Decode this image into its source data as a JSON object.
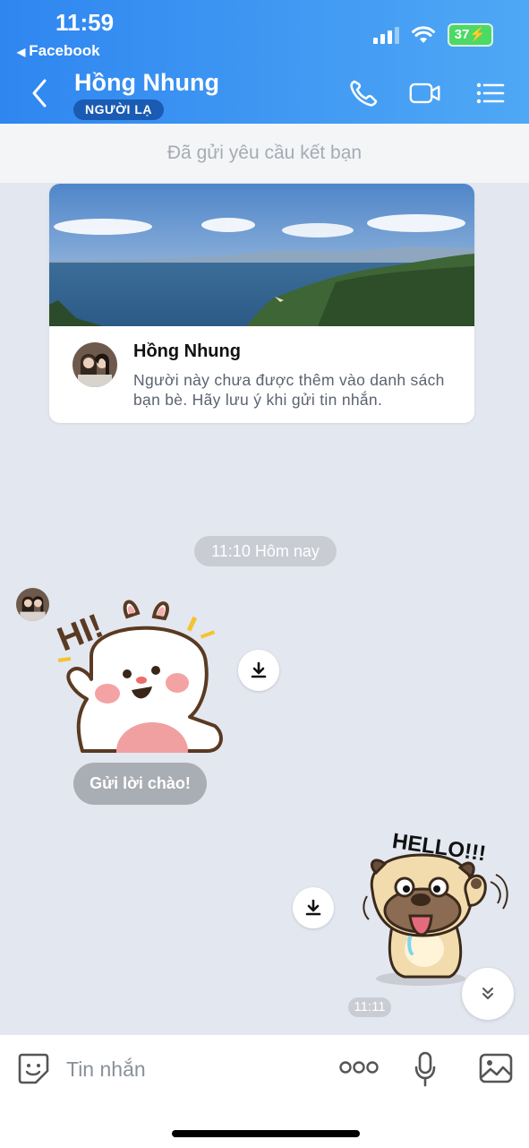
{
  "status_bar": {
    "time": "11:59",
    "back_app": "Facebook",
    "battery": "37"
  },
  "header": {
    "contact_name": "Hồng Nhung",
    "badge": "NGƯỜI LẠ"
  },
  "friend_request_bar": "Đã gửi yêu cầu kết bạn",
  "profile_card": {
    "name": "Hồng Nhung",
    "note": "Người này chưa được thêm vào danh sách bạn bè. Hãy lưu ý khi gửi tin nhắn."
  },
  "chat": {
    "time_separator": "11:10 Hôm nay",
    "bunny_sticker_text": "HI!",
    "greeting_button": "Gửi lời chào!",
    "pug_sticker_text": "HELLO!!!",
    "sent_time": "11:11"
  },
  "input_bar": {
    "placeholder": "Tin nhắn"
  },
  "colors": {
    "header_gradient_start": "#2f86f0",
    "header_gradient_end": "#4fa8f5",
    "badge": "#1a5bb3",
    "chat_background": "#e3e7ef"
  }
}
